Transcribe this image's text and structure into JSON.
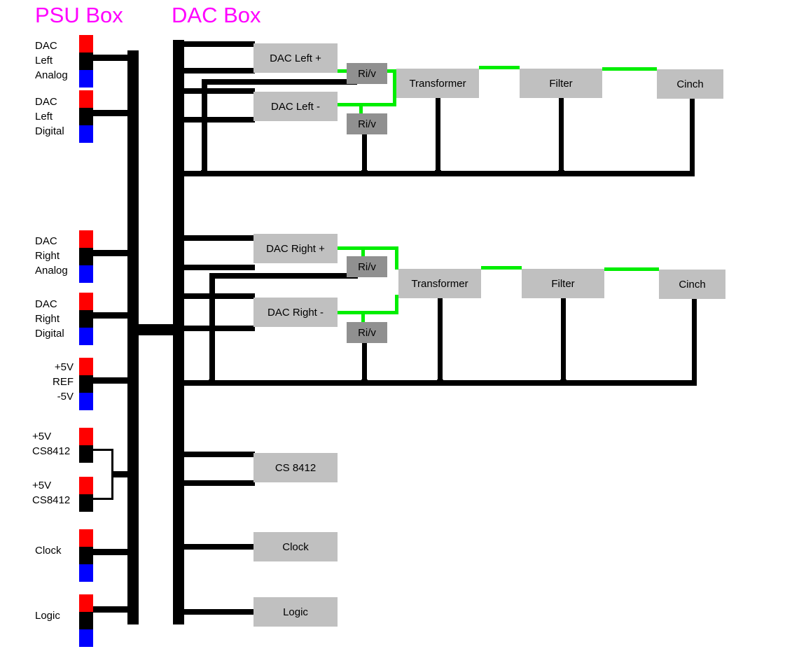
{
  "titles": {
    "psu": "PSU Box",
    "dac": "DAC Box",
    "color": "#ff00ff"
  },
  "colors": {
    "block_fill": "#c0c0c0",
    "riv_fill": "#909090",
    "wire": "#000000",
    "signal": "#00ee00",
    "positive_rail": "#ff0000",
    "ground_rail": "#000000",
    "negative_rail": "#0000ff",
    "background": "#ffffff"
  },
  "psu_supplies": [
    {
      "id": "dac-left-analog",
      "label": "DAC\nLeft\nAnalog",
      "lines": [
        "DAC",
        "Left",
        "Analog"
      ],
      "rails": [
        "red",
        "black",
        "blue"
      ],
      "align": "left"
    },
    {
      "id": "dac-left-digital",
      "label": "DAC\nLeft\nDigital",
      "lines": [
        "DAC",
        "Left",
        "Digital"
      ],
      "rails": [
        "red",
        "black",
        "blue"
      ],
      "align": "left"
    },
    {
      "id": "dac-right-analog",
      "label": "DAC\nRight\nAnalog",
      "lines": [
        "DAC",
        "Right",
        "Analog"
      ],
      "rails": [
        "red",
        "black",
        "blue"
      ],
      "align": "left"
    },
    {
      "id": "dac-right-digital",
      "label": "DAC\nRight\nDigital",
      "lines": [
        "DAC",
        "Right",
        "Digital"
      ],
      "rails": [
        "red",
        "black",
        "blue"
      ],
      "align": "left"
    },
    {
      "id": "ref-supply",
      "label": "+5V\nREF\n-5V",
      "lines": [
        "+5V",
        "REF",
        "-5V"
      ],
      "rails": [
        "red",
        "black",
        "blue"
      ],
      "align": "right"
    },
    {
      "id": "cs8412-supply-1",
      "label": "+5V\nCS8412",
      "lines": [
        "+5V",
        "CS8412"
      ],
      "rails": [
        "red",
        "black"
      ],
      "align": "left"
    },
    {
      "id": "cs8412-supply-2",
      "label": "+5V\nCS8412",
      "lines": [
        "+5V",
        "CS8412"
      ],
      "rails": [
        "red",
        "black"
      ],
      "align": "left"
    },
    {
      "id": "clock-supply",
      "label": "Clock",
      "lines": [
        "Clock"
      ],
      "rails": [
        "red",
        "black",
        "blue"
      ],
      "align": "left"
    },
    {
      "id": "logic-supply",
      "label": "Logic",
      "lines": [
        "Logic"
      ],
      "rails": [
        "red",
        "black",
        "blue"
      ],
      "align": "left"
    }
  ],
  "dac_blocks": {
    "left_plus": "DAC Left +",
    "left_minus": "DAC Left -",
    "right_plus": "DAC Right +",
    "right_minus": "DAC Right -",
    "cs8412": "CS 8412",
    "clock": "Clock",
    "logic": "Logic"
  },
  "riv_blocks": {
    "left_plus": "Ri/v",
    "left_minus": "Ri/v",
    "right_plus": "Ri/v",
    "right_minus": "Ri/v"
  },
  "output_chain_left": {
    "transformer": "Transformer",
    "filter": "Filter",
    "cinch": "Cinch"
  },
  "output_chain_right": {
    "transformer": "Transformer",
    "filter": "Filter",
    "cinch": "Cinch"
  }
}
